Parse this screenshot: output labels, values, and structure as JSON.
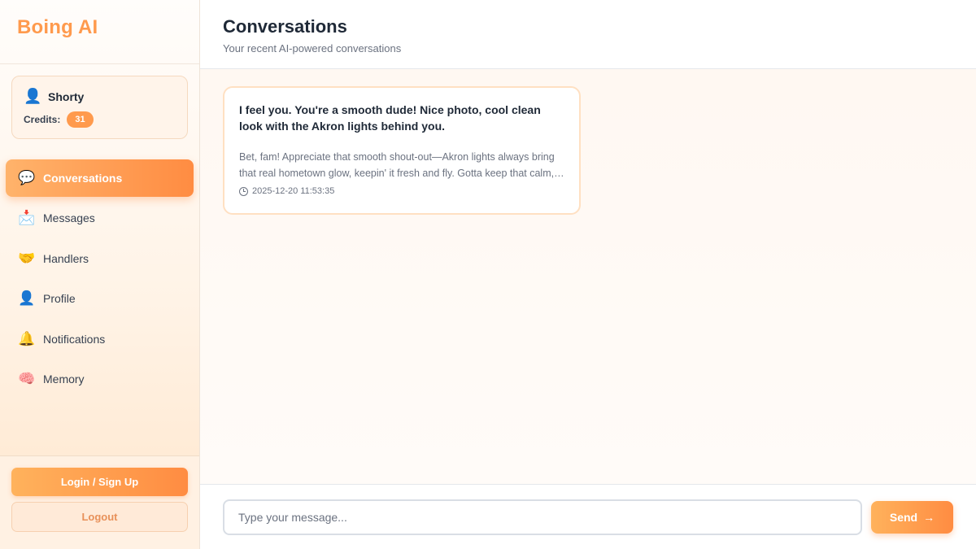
{
  "brand": {
    "title": "Boing AI",
    "color": "#ff9a4d"
  },
  "user": {
    "icon": "user-icon",
    "name": "Shorty",
    "credits_label": "Credits:",
    "credits_value": "31"
  },
  "nav": {
    "items": [
      {
        "label": "Conversations",
        "icon": "💬",
        "icon_name": "speech-bubble-icon",
        "active": true
      },
      {
        "label": "Messages",
        "icon": "📩",
        "icon_name": "envelope-icon",
        "active": false
      },
      {
        "label": "Handlers",
        "icon": "🤝",
        "icon_name": "handshake-icon",
        "active": false
      },
      {
        "label": "Profile",
        "icon": "👤",
        "icon_name": "user-icon",
        "active": false
      },
      {
        "label": "Notifications",
        "icon": "🔔",
        "icon_name": "bell-icon",
        "active": false
      },
      {
        "label": "Memory",
        "icon": "🧠",
        "icon_name": "brain-icon",
        "active": false
      }
    ]
  },
  "footer": {
    "login_label": "Login / Sign Up",
    "logout_label": "Logout"
  },
  "header": {
    "title": "Conversations",
    "subtitle": "Your recent AI-powered conversations"
  },
  "conversations": [
    {
      "title": "I feel you. You're a smooth dude! Nice photo, cool clean look with the Akron lights behind you.",
      "preview": "Bet, fam! Appreciate that smooth shout-out—Akron lights always bring that real hometown glow, keepin' it fresh and fly. Gotta keep that calm, collected vibe going strong.",
      "timestamp": "2025-12-20 11:53:35"
    }
  ],
  "composer": {
    "placeholder": "Type your message...",
    "value": "",
    "send_label": "Send",
    "send_arrow": "→"
  },
  "colors": {
    "accent": "#ff8c42",
    "accent_light": "#ffb36b"
  }
}
